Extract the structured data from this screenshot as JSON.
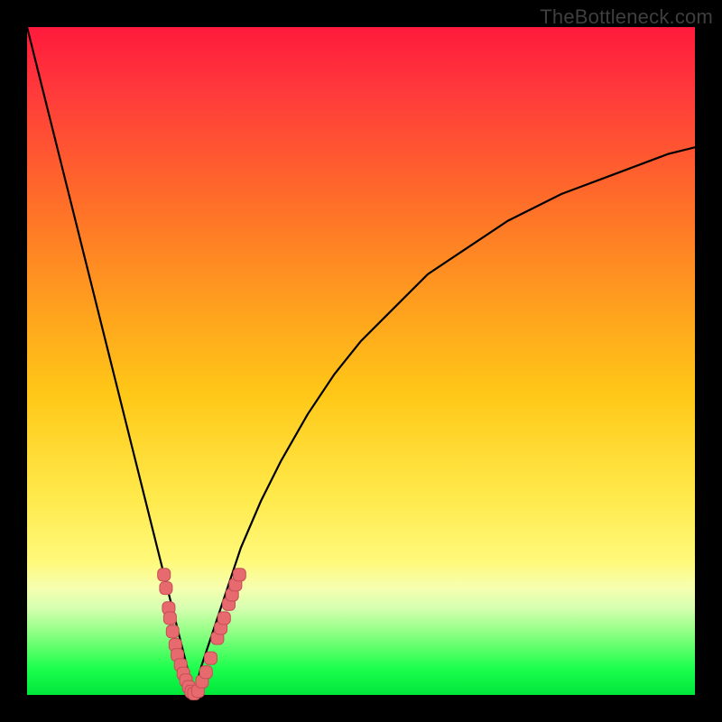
{
  "watermark": "TheBottleneck.com",
  "colors": {
    "frame": "#000000",
    "curve": "#000000",
    "marker_fill": "#e66a6e",
    "marker_stroke": "#c54f56",
    "gradient_top": "#ff1a3c",
    "gradient_bottom": "#00e63b"
  },
  "chart_data": {
    "type": "line",
    "title": "",
    "xlabel": "",
    "ylabel": "",
    "xlim": [
      0,
      100
    ],
    "ylim": [
      0,
      100
    ],
    "x": [
      0,
      2,
      4,
      6,
      8,
      10,
      12,
      14,
      16,
      18,
      20,
      22,
      23,
      24,
      25,
      26,
      28,
      30,
      32,
      35,
      38,
      42,
      46,
      50,
      55,
      60,
      66,
      72,
      80,
      88,
      96,
      100
    ],
    "values": [
      100,
      92,
      84,
      76,
      68,
      60,
      52,
      44,
      36,
      28,
      20,
      12,
      8,
      4,
      0,
      4,
      10,
      16,
      22,
      29,
      35,
      42,
      48,
      53,
      58,
      63,
      67,
      71,
      75,
      78,
      81,
      82
    ],
    "optimum_x": 25,
    "markers": [
      {
        "x": 20.5,
        "y": 18
      },
      {
        "x": 20.8,
        "y": 16
      },
      {
        "x": 21.2,
        "y": 13
      },
      {
        "x": 21.4,
        "y": 11.5
      },
      {
        "x": 21.8,
        "y": 9.5
      },
      {
        "x": 22.2,
        "y": 7.5
      },
      {
        "x": 22.5,
        "y": 6
      },
      {
        "x": 23.0,
        "y": 4.5
      },
      {
        "x": 23.4,
        "y": 3.2
      },
      {
        "x": 23.8,
        "y": 2.2
      },
      {
        "x": 24.2,
        "y": 1.2
      },
      {
        "x": 24.6,
        "y": 0.5
      },
      {
        "x": 25.0,
        "y": 0.2
      },
      {
        "x": 25.6,
        "y": 0.6
      },
      {
        "x": 26.2,
        "y": 2.0
      },
      {
        "x": 26.8,
        "y": 3.4
      },
      {
        "x": 27.5,
        "y": 5.5
      },
      {
        "x": 28.5,
        "y": 8.5
      },
      {
        "x": 29.0,
        "y": 10.0
      },
      {
        "x": 29.5,
        "y": 11.5
      },
      {
        "x": 30.2,
        "y": 13.6
      },
      {
        "x": 30.7,
        "y": 15.0
      },
      {
        "x": 31.2,
        "y": 16.5
      },
      {
        "x": 31.8,
        "y": 18.0
      }
    ]
  }
}
